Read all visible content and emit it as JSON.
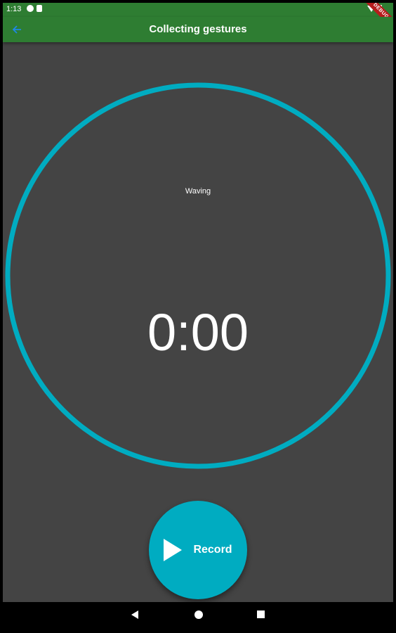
{
  "status_bar": {
    "time": "1:13",
    "debug_banner": "DEBUG"
  },
  "app_bar": {
    "title": "Collecting gestures",
    "back_icon": "arrow-back-icon"
  },
  "gesture": {
    "label": "Waving"
  },
  "timer": {
    "value": "0:00"
  },
  "record_button": {
    "label": "Record",
    "icon": "play-icon"
  },
  "colors": {
    "app_bar": "#2e7d32",
    "background": "#444444",
    "accent": "#00acc1",
    "back_icon": "#1e88e5"
  }
}
